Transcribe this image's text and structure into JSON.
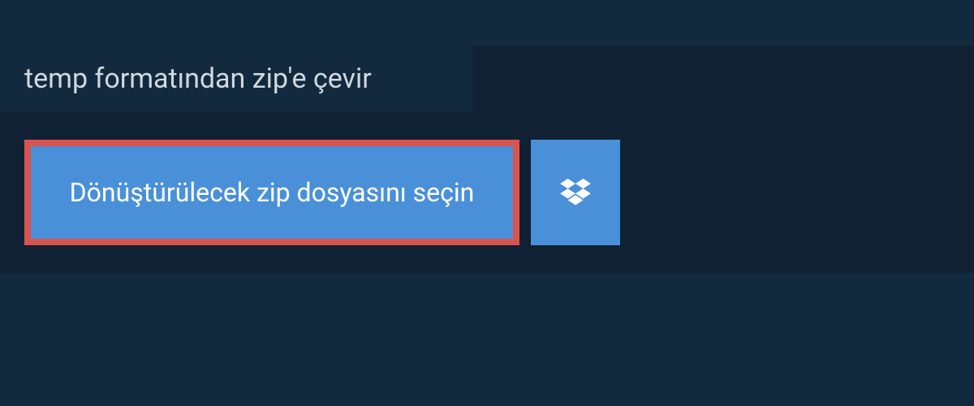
{
  "header": {
    "title": "temp formatından zip'e çevir"
  },
  "actions": {
    "select_file_label": "Dönüştürülecek zip dosyasını seçin"
  }
}
